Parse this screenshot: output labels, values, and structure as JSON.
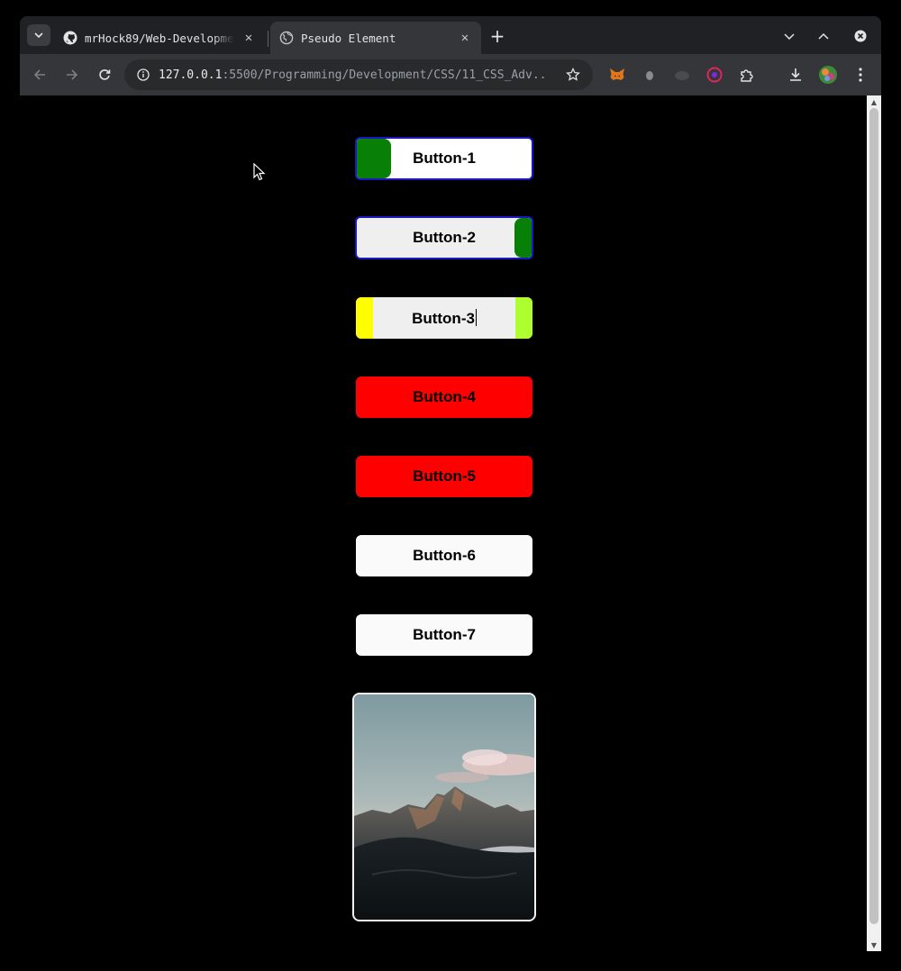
{
  "browser": {
    "tabs": [
      {
        "title": "mrHock89/Web-Developme",
        "icon": "github-icon",
        "active": false
      },
      {
        "title": "Pseudo Element",
        "icon": "globe-icon",
        "active": true
      }
    ],
    "address": {
      "host": "127.0.0.1",
      "path": ":5500/Programming/Development/CSS/11_CSS_Adv..."
    }
  },
  "page": {
    "buttons": [
      {
        "label": "Button-1",
        "style": "left-green-pill"
      },
      {
        "label": "Button-2",
        "style": "right-green-pill"
      },
      {
        "label": "Button-3",
        "style": "yellow-side-bars"
      },
      {
        "label": "Button-4",
        "style": "red"
      },
      {
        "label": "Button-5",
        "style": "red"
      },
      {
        "label": "Button-6",
        "style": "white"
      },
      {
        "label": "Button-7",
        "style": "white"
      }
    ],
    "card": {
      "image": "mountain-landscape-photo"
    }
  },
  "colors": {
    "page_background": "#000000",
    "button_border": "#1a17c2",
    "green_pill": "#088008",
    "yellow_bar": "#ffff00",
    "greenyellow_bar": "#adff2f",
    "red_button": "#ff0000"
  }
}
